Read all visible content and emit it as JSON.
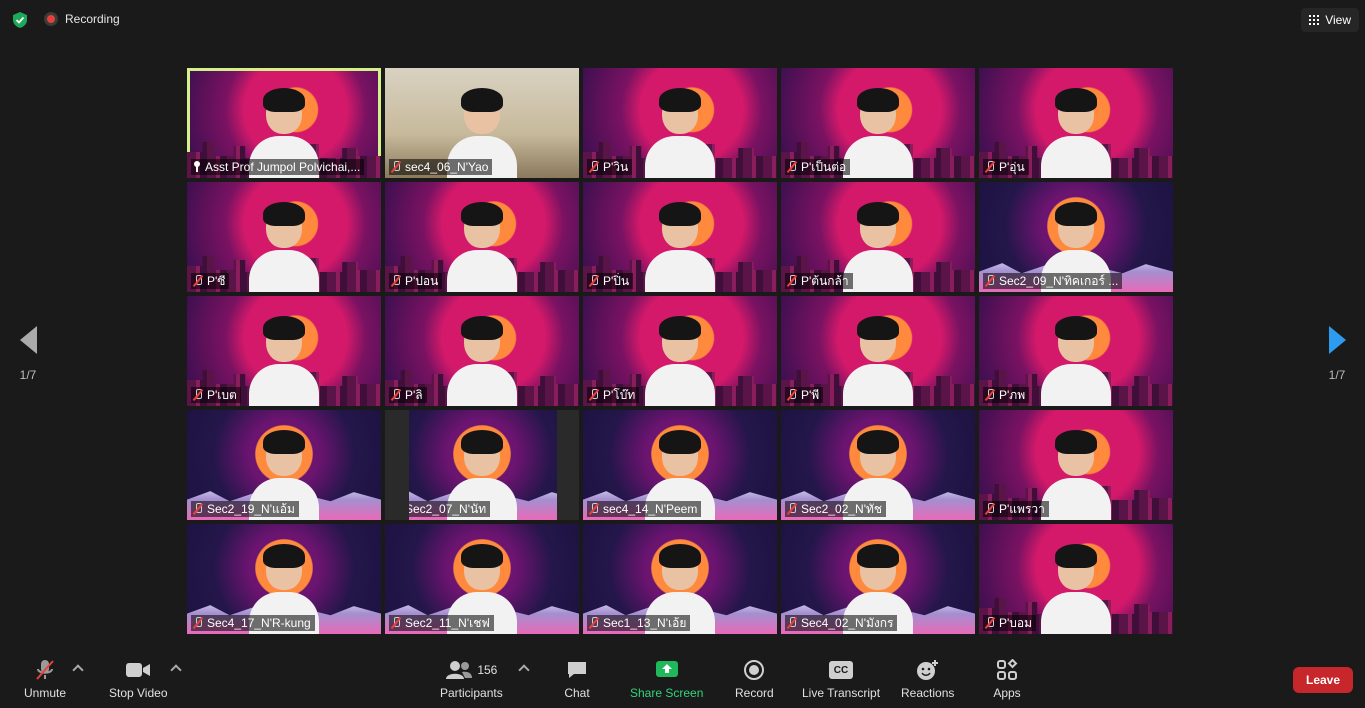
{
  "topbar": {
    "recording_label": "Recording",
    "view_label": "View"
  },
  "pagination": {
    "left": "1/7",
    "right": "1/7"
  },
  "participants": [
    {
      "name": "Asst Prof Jumpol Polvichai,...",
      "bg": "a",
      "active": true,
      "icon": "pin-icon"
    },
    {
      "name": "sec4_06_N'Yao",
      "bg": "room"
    },
    {
      "name": "P'วิน",
      "bg": "a"
    },
    {
      "name": "P'เป็นต่อ",
      "bg": "a"
    },
    {
      "name": "P'อุ่น",
      "bg": "a"
    },
    {
      "name": "P'ซี",
      "bg": "a"
    },
    {
      "name": "P'ปอน",
      "bg": "a"
    },
    {
      "name": "P'ปิ่น",
      "bg": "a"
    },
    {
      "name": "P'ต้นกล้า",
      "bg": "a"
    },
    {
      "name": "Sec2_09_N'ทิคเกอร์ ...",
      "bg": "b"
    },
    {
      "name": "P'เบต",
      "bg": "a"
    },
    {
      "name": "P'ลิ",
      "bg": "a"
    },
    {
      "name": "P'โบ๊ท",
      "bg": "a"
    },
    {
      "name": "P'พี",
      "bg": "a"
    },
    {
      "name": "P'ภพ",
      "bg": "a"
    },
    {
      "name": "Sec2_19_N'แอ้ม",
      "bg": "b"
    },
    {
      "name": "Sec2_07_N'นัท",
      "bg": "b",
      "narrow": true
    },
    {
      "name": "sec4_14_N'Peem",
      "bg": "b"
    },
    {
      "name": "Sec2_02_N'ทัช",
      "bg": "b"
    },
    {
      "name": "P'แพรวา",
      "bg": "a"
    },
    {
      "name": "Sec4_17_N'R-kung",
      "bg": "b"
    },
    {
      "name": "Sec2_11_N'เชฟ",
      "bg": "b"
    },
    {
      "name": "Sec1_13_N'เอ้ย",
      "bg": "b"
    },
    {
      "name": "Sec4_02_N'มังกร",
      "bg": "b"
    },
    {
      "name": "P'บอม",
      "bg": "a"
    }
  ],
  "toolbar": {
    "unmute": "Unmute",
    "stop_video": "Stop Video",
    "participants": "Participants",
    "participants_count": "156",
    "chat": "Chat",
    "share_screen": "Share Screen",
    "record": "Record",
    "live_transcript": "Live Transcript",
    "cc": "CC",
    "reactions": "Reactions",
    "apps": "Apps",
    "leave": "Leave"
  },
  "colors": {
    "active_speaker": "#d4f08a",
    "share_green": "#34d37b",
    "leave_red": "#c7262b",
    "next_arrow": "#2d9bf0"
  }
}
